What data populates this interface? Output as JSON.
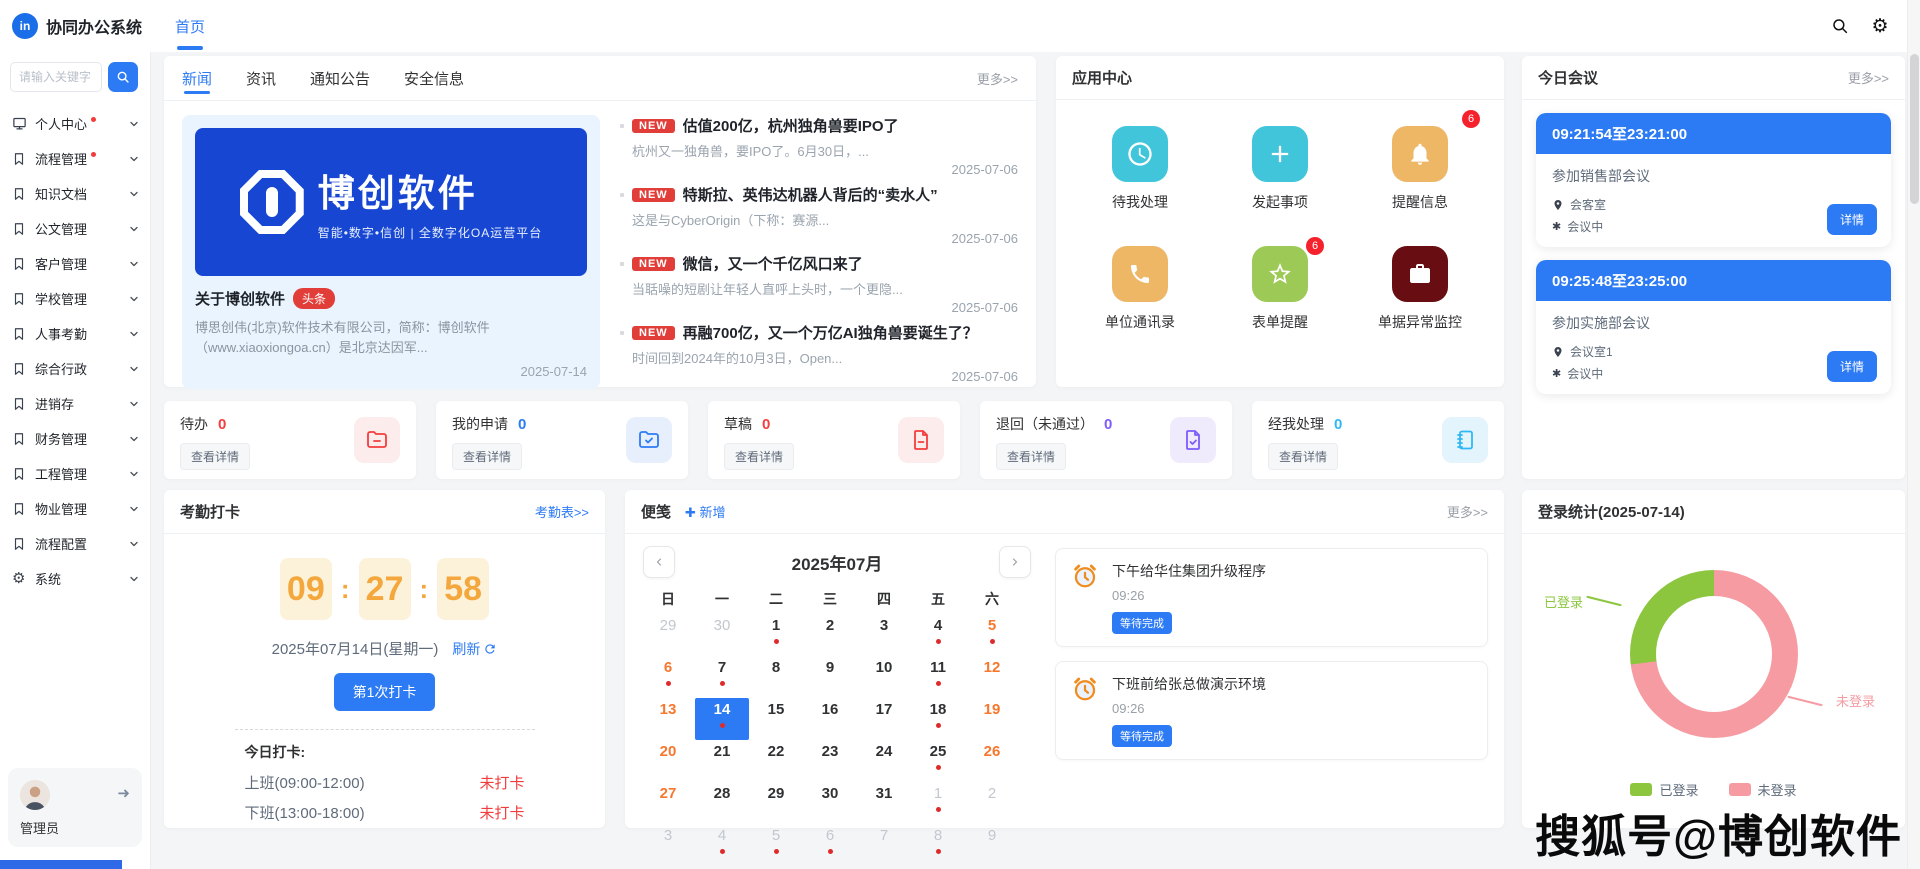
{
  "app": {
    "title": "协同办公系统",
    "logo_text": "in"
  },
  "topbar": {
    "icons": [
      "search-icon",
      "gear-icon"
    ]
  },
  "tabs": {
    "home": "首页"
  },
  "colors": {
    "primary": "#2d7bf4",
    "banner_blue": "#1747d2",
    "badge_red": "#f5222d",
    "app_cyan": "#41c5da",
    "app_tan": "#edb766",
    "app_green": "#9dc957",
    "app_maroon": "#680d12",
    "clock_orange": "#f3a73c",
    "weekend_orange": "#f7772e",
    "donut_green": "#8cc63f",
    "donut_pink": "#f59ba1"
  },
  "sidebar": {
    "search_placeholder": "请输入关键字",
    "items": [
      {
        "label": "个人中心",
        "icon": "monitor-icon",
        "dot": true
      },
      {
        "label": "流程管理",
        "icon": "bookmark-icon",
        "dot": true
      },
      {
        "label": "知识文档",
        "icon": "bookmark-icon",
        "dot": false
      },
      {
        "label": "公文管理",
        "icon": "bookmark-icon",
        "dot": false
      },
      {
        "label": "客户管理",
        "icon": "bookmark-icon",
        "dot": false
      },
      {
        "label": "学校管理",
        "icon": "bookmark-icon",
        "dot": false
      },
      {
        "label": "人事考勤",
        "icon": "bookmark-icon",
        "dot": false
      },
      {
        "label": "综合行政",
        "icon": "bookmark-icon",
        "dot": false
      },
      {
        "label": "进销存",
        "icon": "bookmark-icon",
        "dot": false
      },
      {
        "label": "财务管理",
        "icon": "bookmark-icon",
        "dot": false
      },
      {
        "label": "工程管理",
        "icon": "bookmark-icon",
        "dot": false
      },
      {
        "label": "物业管理",
        "icon": "bookmark-icon",
        "dot": false
      },
      {
        "label": "流程配置",
        "icon": "bookmark-icon",
        "dot": false
      },
      {
        "label": "系统",
        "icon": "gear-icon",
        "dot": false
      }
    ],
    "user": {
      "name": "管理员"
    }
  },
  "news": {
    "tabs": [
      {
        "label": "新闻",
        "active": true
      },
      {
        "label": "资讯",
        "active": false
      },
      {
        "label": "通知公告",
        "active": false
      },
      {
        "label": "安全信息",
        "active": false
      }
    ],
    "more": "更多>>",
    "featured": {
      "banner_brand": "博创软件",
      "banner_slogan": "智能•数字•信创 | 全数字化OA运营平台",
      "title": "关于博创软件",
      "badge": "头条",
      "desc": "博思创伟(北京)软件技术有限公司，简称：博创软件（www.xiaoxiongoa.cn）是北京达因军...",
      "date": "2025-07-14"
    },
    "items": [
      {
        "badge": "NEW",
        "title": "估值200亿，杭州独角兽要IPO了",
        "desc": "杭州又一独角兽，要IPO了。6月30日，...",
        "date": "2025-07-06"
      },
      {
        "badge": "NEW",
        "title": "特斯拉、英伟达机器人背后的“卖水人”",
        "desc": "这是与CyberOrigin（下称：赛源...",
        "date": "2025-07-06"
      },
      {
        "badge": "NEW",
        "title": "微信，又一个千亿风口来了",
        "desc": "当聒噪的短剧让年轻人直呼上头时，一个更隐...",
        "date": "2025-07-06"
      },
      {
        "badge": "NEW",
        "title": "再融700亿，又一个万亿AI独角兽要诞生了？",
        "desc": "时间回到2024年的10月3日，Open...",
        "date": "2025-07-06"
      }
    ]
  },
  "app_center": {
    "title": "应用中心",
    "apps": [
      {
        "label": "待我处理",
        "icon": "clock-icon",
        "color": "#41c5da",
        "badge": ""
      },
      {
        "label": "发起事项",
        "icon": "plus-icon",
        "color": "#41c5da",
        "badge": ""
      },
      {
        "label": "提醒信息",
        "icon": "bell-icon",
        "color": "#edb766",
        "badge": "6"
      },
      {
        "label": "单位通讯录",
        "icon": "phone-icon",
        "color": "#edb766",
        "badge": ""
      },
      {
        "label": "表单提醒",
        "icon": "star-icon",
        "color": "#9dc957",
        "badge": "6"
      },
      {
        "label": "单据异常监控",
        "icon": "briefcase-icon",
        "color": "#680d12",
        "badge": ""
      }
    ]
  },
  "meetings": {
    "title": "今日会议",
    "more": "更多>>",
    "items": [
      {
        "time": "09:21:54至23:21:00",
        "title": "参加销售部会议",
        "location": "会客室",
        "status": "会议中",
        "detail_label": "详情"
      },
      {
        "time": "09:25:48至23:25:00",
        "title": "参加实施部会议",
        "location": "会议室1",
        "status": "会议中",
        "detail_label": "详情"
      }
    ]
  },
  "stats": [
    {
      "label": "待办",
      "value": "0",
      "link": "查看详情",
      "icon": "folder-minus-icon",
      "color": "#f43d3d"
    },
    {
      "label": "我的申请",
      "value": "0",
      "link": "查看详情",
      "icon": "folder-check-icon",
      "color": "#2d7bf4"
    },
    {
      "label": "草稿",
      "value": "0",
      "link": "查看详情",
      "icon": "doc-minus-icon",
      "color": "#f43d3d"
    },
    {
      "label": "退回（未通过）",
      "value": "0",
      "link": "查看详情",
      "icon": "doc-check-icon",
      "color": "#7c5cfa"
    },
    {
      "label": "经我处理",
      "value": "0",
      "link": "查看详情",
      "icon": "notebook-icon",
      "color": "#2eb8f5"
    }
  ],
  "attendance": {
    "title": "考勤打卡",
    "link": "考勤表>>",
    "clock": {
      "h": "09",
      "m": "27",
      "s": "58"
    },
    "date": "2025年07月14日(星期一)",
    "refresh": "刷新",
    "punch_button": "第1次打卡",
    "today_label": "今日打卡:",
    "records": [
      {
        "label": "上班(09:00-12:00)",
        "status": "未打卡"
      },
      {
        "label": "下班(13:00-18:00)",
        "status": "未打卡"
      }
    ]
  },
  "notes": {
    "title": "便笺",
    "add": "新增",
    "more": "更多>>",
    "calendar": {
      "month": "2025年07月",
      "weekdays": [
        "日",
        "一",
        "二",
        "三",
        "四",
        "五",
        "六"
      ],
      "weeks": [
        [
          {
            "d": "29",
            "o": true
          },
          {
            "d": "30",
            "o": true
          },
          {
            "d": "1",
            "dot": true
          },
          {
            "d": "2"
          },
          {
            "d": "3"
          },
          {
            "d": "4",
            "dot": true
          },
          {
            "d": "5",
            "w": true,
            "dot": true
          }
        ],
        [
          {
            "d": "6",
            "w": true,
            "dot": true
          },
          {
            "d": "7",
            "dot": true
          },
          {
            "d": "8"
          },
          {
            "d": "9"
          },
          {
            "d": "10"
          },
          {
            "d": "11",
            "dot": true
          },
          {
            "d": "12",
            "w": true
          }
        ],
        [
          {
            "d": "13",
            "w": true
          },
          {
            "d": "14",
            "sel": true,
            "dot": true
          },
          {
            "d": "15"
          },
          {
            "d": "16"
          },
          {
            "d": "17"
          },
          {
            "d": "18",
            "dot": true
          },
          {
            "d": "19",
            "w": true
          }
        ],
        [
          {
            "d": "20",
            "w": true
          },
          {
            "d": "21"
          },
          {
            "d": "22"
          },
          {
            "d": "23"
          },
          {
            "d": "24"
          },
          {
            "d": "25",
            "dot": true
          },
          {
            "d": "26",
            "w": true
          }
        ],
        [
          {
            "d": "27",
            "w": true
          },
          {
            "d": "28"
          },
          {
            "d": "29"
          },
          {
            "d": "30"
          },
          {
            "d": "31"
          },
          {
            "d": "1",
            "o": true,
            "dot": true
          },
          {
            "d": "2",
            "o": true
          }
        ],
        [
          {
            "d": "3",
            "o": true
          },
          {
            "d": "4",
            "o": true,
            "dot": true
          },
          {
            "d": "5",
            "o": true,
            "dot": true
          },
          {
            "d": "6",
            "o": true,
            "dot": true
          },
          {
            "d": "7",
            "o": true
          },
          {
            "d": "8",
            "o": true,
            "dot": true
          },
          {
            "d": "9",
            "o": true
          }
        ]
      ]
    },
    "items": [
      {
        "icon": "alarm-icon",
        "title": "下午给华住集团升级程序",
        "time": "09:26",
        "tag": "等待完成"
      },
      {
        "icon": "alarm-icon",
        "title": "下班前给张总做演示环境",
        "time": "09:26",
        "tag": "等待完成"
      }
    ]
  },
  "login_stats": {
    "title": "登录统计(2025-07-14)",
    "chart_data": {
      "type": "pie",
      "labels": [
        "已登录",
        "未登录"
      ],
      "values_pct": [
        27,
        73
      ],
      "colors": [
        "#8cc63f",
        "#f59ba1"
      ],
      "legend": [
        "已登录",
        "未登录"
      ],
      "legend_position": "bottom"
    },
    "callout_logged_in": "已登录",
    "callout_not_logged_in": "未登录"
  },
  "watermark": "搜狐号@博创软件"
}
